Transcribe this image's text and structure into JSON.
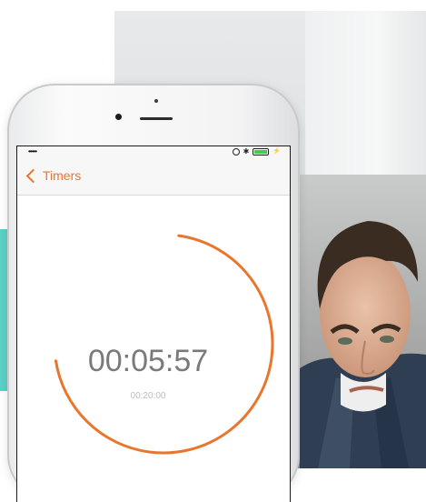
{
  "status_bar": {
    "signal": "•••••"
  },
  "navigation": {
    "back_label": "Timers"
  },
  "timer": {
    "remaining": "00:05:57",
    "total": "00:20:00",
    "progress_fraction": 0.7025,
    "ring_color": "#e8762c"
  },
  "colors": {
    "accent": "#e8762c",
    "teal_panel": "#5dd0c6"
  }
}
